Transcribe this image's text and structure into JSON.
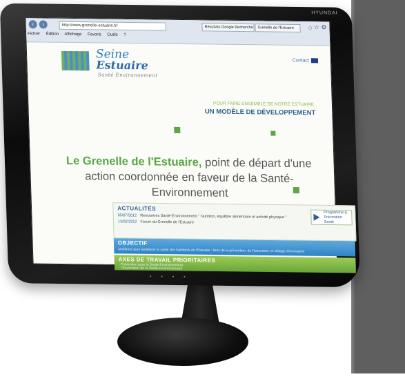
{
  "browser": {
    "address": "http://www.grenelle-estuaire.fr/",
    "tab1": "Résultats Google Recherche d...",
    "tab2": "Grenelle de l'Estuaire",
    "menu": [
      "Fichier",
      "Édition",
      "Affichage",
      "Favoris",
      "Outils",
      "?"
    ]
  },
  "site": {
    "logo_line1": "Seine",
    "logo_line2": "Estuaire",
    "logo_line3": "Santé Environnement",
    "contact": "Contact",
    "tagline_small": "POUR FAIRE ENSEMBLE DE NOTRE ESTUAIRE,",
    "tagline_big": "UN MODÈLE DE DÉVELOPPEMENT",
    "headline_strong": "Le Grenelle de l'Estuaire,",
    "headline_rest": " point de départ d'une action coordonnée en faveur de la Santé-Environnement"
  },
  "news": {
    "title": "ACTUALITÉS",
    "items": [
      {
        "date": "05/07/2012",
        "text": "Rencontres Santé-Environnement \" Nutrition, équilibre alimentaire et activité physique \""
      },
      {
        "date": "13/02/2012",
        "text": "Forum du Grenelle de l'Estuaire"
      }
    ],
    "badge": "Programme & Prévention Santé"
  },
  "objectif": {
    "title": "OBJECTIF",
    "text": "améliorer pour améliorer la santé des habitants de l'Estuaire : liens de la prévention, de l'éducation, et ciblage d'innovation"
  },
  "axes": {
    "title": "AXES DE TRAVAIL PRIORITAIRES",
    "items": [
      "- Prévention pour la Santé Environnement",
      "- Observation de la Santé-Environnement"
    ]
  },
  "monitor": {
    "brand": "HYUNDAI"
  }
}
